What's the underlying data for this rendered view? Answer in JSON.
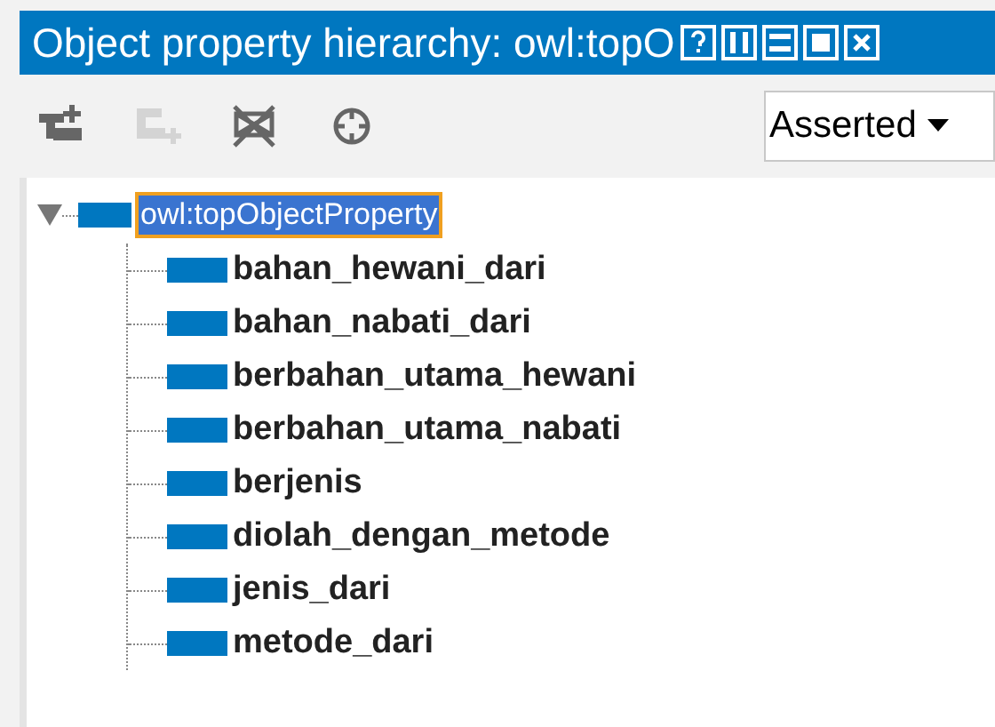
{
  "window": {
    "title": "Object property hierarchy: owl:topO"
  },
  "toolbar": [
    {
      "kind": "add-sub",
      "disabled": false
    },
    {
      "kind": "add-sibling",
      "disabled": true
    },
    {
      "kind": "delete",
      "disabled": false
    },
    {
      "kind": "target",
      "disabled": false
    }
  ],
  "view_selector": {
    "value": "Asserted"
  },
  "tree": [
    {
      "label": "owl:topObjectProperty",
      "selected": true,
      "expanded": true,
      "children": [
        {
          "label": "bahan_hewani_dari",
          "selected": false
        },
        {
          "label": "bahan_nabati_dari",
          "selected": false
        },
        {
          "label": "berbahan_utama_hewani",
          "selected": false
        },
        {
          "label": "berbahan_utama_nabati",
          "selected": false
        },
        {
          "label": "berjenis",
          "selected": false
        },
        {
          "label": "diolah_dengan_metode",
          "selected": false
        },
        {
          "label": "jenis_dari",
          "selected": false
        },
        {
          "label": "metode_dari",
          "selected": false
        }
      ]
    }
  ]
}
